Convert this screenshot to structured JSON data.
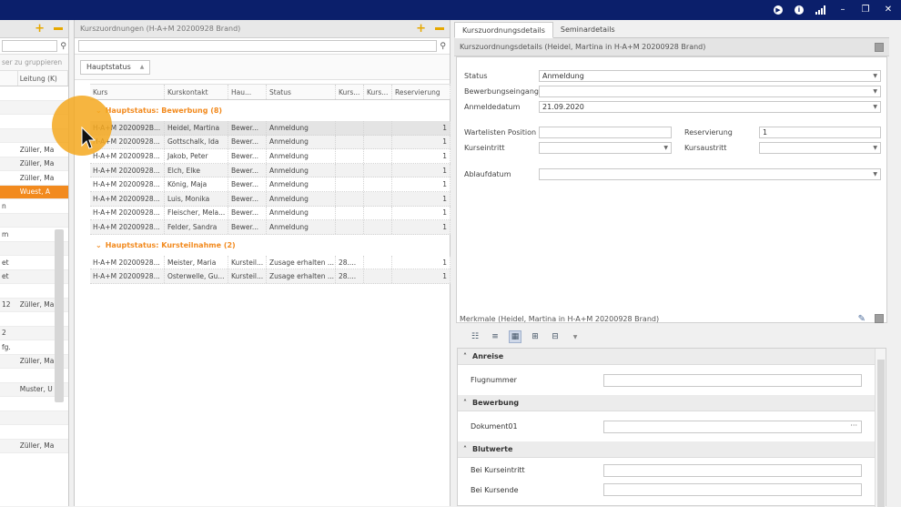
{
  "titlebar": {
    "icons": [
      "play-icon",
      "info-icon",
      "signal-icon",
      "minimize-icon",
      "restore-icon",
      "close-icon"
    ],
    "info_glyph": "i"
  },
  "left": {
    "group_hint": "ser zu gruppieren",
    "columns": [
      "",
      "Leitung (K)"
    ],
    "rows": [
      {
        "a": "",
        "b": ""
      },
      {
        "a": "",
        "b": ""
      },
      {
        "a": "",
        "b": ""
      },
      {
        "a": "",
        "b": ""
      },
      {
        "a": "",
        "b": "Züller, Ma"
      },
      {
        "a": "",
        "b": "Züller, Ma"
      },
      {
        "a": "",
        "b": "Züller, Ma"
      },
      {
        "a": "",
        "b": "Wuest, A"
      },
      {
        "a": "n",
        "b": ""
      },
      {
        "a": "",
        "b": ""
      },
      {
        "a": "m",
        "b": ""
      },
      {
        "a": "",
        "b": ""
      },
      {
        "a": "et",
        "b": ""
      },
      {
        "a": "et",
        "b": ""
      },
      {
        "a": "",
        "b": ""
      },
      {
        "a": "12",
        "b": "Züller, Ma"
      },
      {
        "a": "",
        "b": ""
      },
      {
        "a": "2",
        "b": ""
      },
      {
        "a": "fg.",
        "b": ""
      },
      {
        "a": "",
        "b": "Züller, Ma"
      },
      {
        "a": "",
        "b": ""
      },
      {
        "a": "",
        "b": "Muster, U"
      },
      {
        "a": "",
        "b": ""
      },
      {
        "a": "",
        "b": ""
      },
      {
        "a": "",
        "b": ""
      },
      {
        "a": "",
        "b": "Züller, Ma"
      }
    ]
  },
  "mid": {
    "title": "Kurszuordnungen (H-A+M 20200928 Brand)",
    "group_chip": "Hauptstatus",
    "columns": [
      "Kurs",
      "Kurskontakt",
      "Hau...",
      "Status",
      "Kurs...",
      "Kurs...",
      "Reservierung"
    ],
    "group1": "Hauptstatus: Bewerbung (8)",
    "group1_rows": [
      [
        "H-A+M 2020092B...",
        "Heidel, Martina",
        "Bewer...",
        "Anmeldung",
        "",
        "",
        "1"
      ],
      [
        "H-A+M 20200928...",
        "Gottschalk, Ida",
        "Bewer...",
        "Anmeldung",
        "",
        "",
        "1"
      ],
      [
        "H-A+M 20200928...",
        "Jakob, Peter",
        "Bewer...",
        "Anmeldung",
        "",
        "",
        "1"
      ],
      [
        "H-A+M 20200928...",
        "Elch, Elke",
        "Bewer...",
        "Anmeldung",
        "",
        "",
        "1"
      ],
      [
        "H-A+M 20200928...",
        "König, Maja",
        "Bewer...",
        "Anmeldung",
        "",
        "",
        "1"
      ],
      [
        "H-A+M 20200928...",
        "Luis, Monika",
        "Bewer...",
        "Anmeldung",
        "",
        "",
        "1"
      ],
      [
        "H-A+M 20200928...",
        "Fleischer, Mela...",
        "Bewer...",
        "Anmeldung",
        "",
        "",
        "1"
      ],
      [
        "H-A+M 20200928...",
        "Felder, Sandra",
        "Bewer...",
        "Anmeldung",
        "",
        "",
        "1"
      ]
    ],
    "group2": "Hauptstatus: Kursteilnahme (2)",
    "group2_rows": [
      [
        "H-A+M 20200928...",
        "Meister, Maria",
        "Kursteil...",
        "Zusage erhalten ...",
        "28....",
        "",
        "1"
      ],
      [
        "H-A+M 20200928...",
        "Osterwelle, Gu...",
        "Kursteil...",
        "Zusage erhalten ...",
        "28....",
        "",
        "1"
      ]
    ]
  },
  "right": {
    "tabs": [
      "Kurszuordnungsdetails",
      "Seminardetails"
    ],
    "header": "Kurszuordnungsdetails (Heidel, Martina in H-A+M 20200928 Brand)",
    "fields": {
      "status_label": "Status",
      "status_value": "Anmeldung",
      "bew_label": "Bewerbungseingang",
      "bew_value": "",
      "anm_label": "Anmeldedatum",
      "anm_value": "21.09.2020",
      "wl_label": "Wartelisten Position",
      "wl_value": "",
      "res_label": "Reservierung",
      "res_value": "1",
      "ke_label": "Kurseintritt",
      "ke_value": "",
      "ka_label": "Kursaustritt",
      "ka_value": "",
      "ab_label": "Ablaufdatum",
      "ab_value": ""
    },
    "merk_header": "Merkmale (Heidel, Martina in H-A+M 20200928 Brand)",
    "cat_anreise": "Anreise",
    "flugnummer": "Flugnummer",
    "cat_bewerbung": "Bewerbung",
    "dokument": "Dokument01",
    "ellipsis": "···",
    "cat_blutwerte": "Blutwerte",
    "bei_eintritt": "Bei Kurseintritt",
    "bei_ende": "Bei Kursende"
  }
}
